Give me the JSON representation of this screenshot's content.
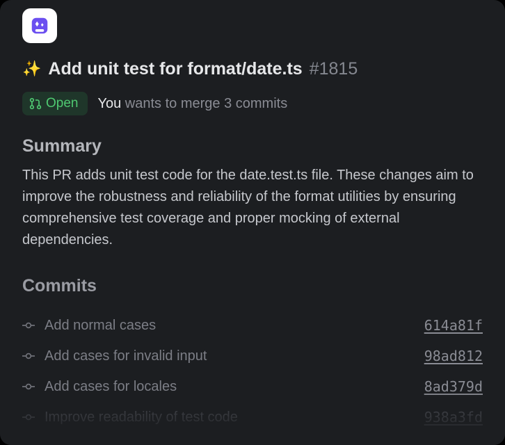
{
  "pr": {
    "sparkle_emoji": "✨",
    "title": "Add unit test for format/date.ts",
    "number": "#1815",
    "status_label": "Open",
    "author_label": "You",
    "merge_tail": "wants to merge 3 commits"
  },
  "summary": {
    "heading": "Summary",
    "body": "This PR adds unit test code for the date.test.ts file. These changes aim to improve the robustness and reliability of the format utilities by ensuring comprehensive test coverage and proper mocking of external dependencies."
  },
  "commits": {
    "heading": "Commits",
    "items": [
      {
        "message": "Add normal cases",
        "hash": "614a81f"
      },
      {
        "message": "Add cases for invalid input",
        "hash": "98ad812"
      },
      {
        "message": "Add cases for locales",
        "hash": "8ad379d"
      },
      {
        "message": "Improve readability of test code",
        "hash": "938a3fd"
      }
    ]
  }
}
